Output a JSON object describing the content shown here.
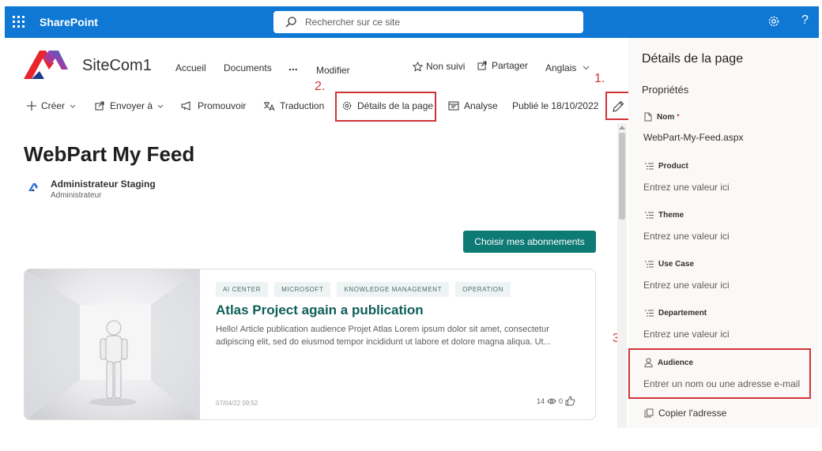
{
  "suitebar": {
    "brand": "SharePoint",
    "search_placeholder": "Rechercher sur ce site",
    "help": "?",
    "icons": [
      "waffle-icon",
      "search-icon",
      "gear-icon"
    ]
  },
  "site": {
    "title": "SiteCom1",
    "nav": [
      "Accueil",
      "Documents"
    ],
    "nav_more": "...",
    "modifier": "Modifier",
    "follow": "Non suivi",
    "share": "Partager",
    "language": "Anglais"
  },
  "steps": {
    "one": "1.",
    "two": "2.",
    "three": "3."
  },
  "commandbar": {
    "create": "Créer",
    "send": "Envoyer à",
    "promote": "Promouvoir",
    "translation": "Traduction",
    "page_details": "Détails de la page",
    "analytics": "Analyse",
    "published": "Publié le 18/10/2022"
  },
  "page": {
    "title": "WebPart My Feed",
    "author_name": "Administrateur Staging",
    "author_role": "Administrateur",
    "subscribe_button": "Choisir mes abonnements"
  },
  "card": {
    "tags": [
      "AI CENTER",
      "MICROSOFT",
      "KNOWLEDGE MANAGEMENT",
      "OPERATION"
    ],
    "title": "Atlas Project again a publication",
    "text": "Hello! Article publication audience Projet Atlas Lorem ipsum dolor sit amet, consectetur adipiscing elit, sed do eiusmod tempor incididunt ut labore et dolore magna aliqua. Ut...",
    "date": "07/04/22 09:52",
    "views": "14",
    "likes": "0"
  },
  "panel": {
    "title": "Détails de la page",
    "subtitle": "Propriétés",
    "name_label": "Nom",
    "required_mark": " *",
    "name_value": "WebPart-My-Feed.aspx",
    "fields": [
      {
        "label": "Product",
        "placeholder": "Entrez une valeur ici"
      },
      {
        "label": "Theme",
        "placeholder": "Entrez une valeur ici"
      },
      {
        "label": "Use Case",
        "placeholder": "Entrez une valeur ici"
      },
      {
        "label": "Departement",
        "placeholder": "Entrez une valeur ici"
      }
    ],
    "audience_label": "Audience",
    "audience_placeholder": "Entrer un nom ou une adresse e-mail",
    "copy_address": "Copier l'adresse"
  },
  "colors": {
    "suitebar": "#0f78d4",
    "accent_teal": "#0e7a74",
    "highlight_red": "#d13438"
  }
}
